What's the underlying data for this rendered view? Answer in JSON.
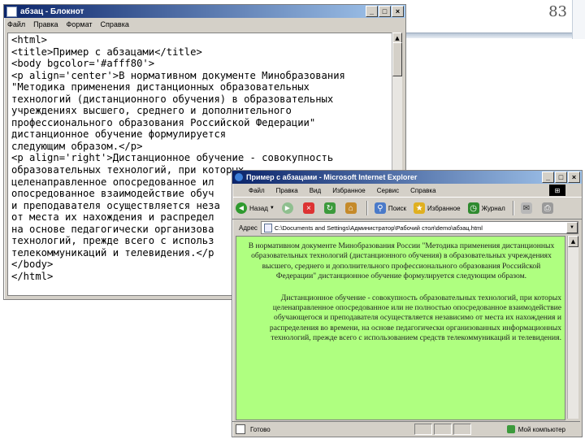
{
  "slide": {
    "number": "83"
  },
  "notepad": {
    "title": "абзац - Блокнот",
    "menu": [
      "Файл",
      "Правка",
      "Формат",
      "Справка"
    ],
    "lines": [
      "<html>",
      "<title>Пример с абзацами</title>",
      "<body bgcolor='#afff80'>",
      "<p align='center'>В нормативном документе Минобразования",
      "\"Методика применения дистанционных образовательных",
      "технологий (дистанционного обучения) в образовательных",
      "учреждениях высшего, среднего и дополнительного",
      "профессионального образования Российской Федерации\"",
      "дистанционное обучение формулируется",
      "следующим образом.</p>",
      "<p align='right'>Дистанционное обучение - совокупность",
      "образовательных технологий, при которых",
      "целенаправленное опосредованное ил",
      "опосредованное взаимодействие обуч",
      "и преподавателя осуществляется неза",
      "от места их нахождения и распредел",
      "на основе педагогически организова",
      "технологий, прежде всего с использ",
      "телекоммуникаций и телевидения.</p",
      "</body>",
      "</html>"
    ]
  },
  "ie": {
    "title": "Пример с абзацами - Microsoft Internet Explorer",
    "menu": [
      "Файл",
      "Правка",
      "Вид",
      "Избранное",
      "Сервис",
      "Справка"
    ],
    "toolbar": {
      "back": "Назад",
      "search": "Поиск",
      "favorites": "Избранное",
      "journal": "Журнал"
    },
    "address_label": "Адрес",
    "address_value": "C:\\Documents and Settings\\Администратор\\Рабочий стол\\demo\\абзац.html",
    "content": {
      "para_center": "В нормативном документе Минобразования России \"Методика применения дистанционных образовательных технологий (дистанционного обучения) в образовательных учреждениях высшего, среднего и дополнительного профессионального образования Российской Федерации\" дистанционное обучение формулируется следующим образом.",
      "para_right": "Дистанционное обучение - совокупность образовательных технологий, при которых целенаправленное опосредованное или не полностью опосредованное взаимодействие обучающегося и преподавателя осуществляется независимо от места их нахождения и распределения во времени, на основе педагогически организованных информационных технологий, прежде всего с использованием средств телекоммуникаций и телевидения."
    },
    "status_left": "Готово",
    "status_right": "Мой компьютер"
  }
}
